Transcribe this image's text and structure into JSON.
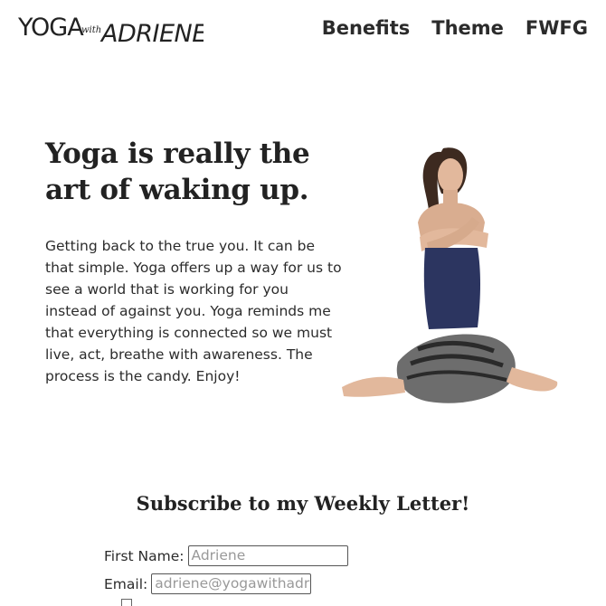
{
  "header": {
    "logo": {
      "text_left": "YOGA",
      "text_with": "with",
      "text_right": "ADRIENE"
    },
    "nav": [
      {
        "label": "Benefits"
      },
      {
        "label": "Theme"
      },
      {
        "label": "FWFG"
      }
    ]
  },
  "hero": {
    "title": "Yoga is really the art of waking up.",
    "body": "Getting back to the true you. It can be that simple. Yoga offers up a way for us to see a world that is working for you instead of against you. Yoga reminds me that everything is connected so we must live, act, breathe with awareness. The process is the candy. Enjoy!"
  },
  "subscribe": {
    "title": "Subscribe to my Weekly Letter!",
    "first_name_label": "First Name:",
    "first_name_placeholder": "Adriene",
    "email_label": "Email:",
    "email_placeholder": "adriene@yogawithadriene.com"
  },
  "colors": {
    "text": "#222222",
    "accent_tank": "#2c3560",
    "accent_pants": "#6d6d6d"
  }
}
